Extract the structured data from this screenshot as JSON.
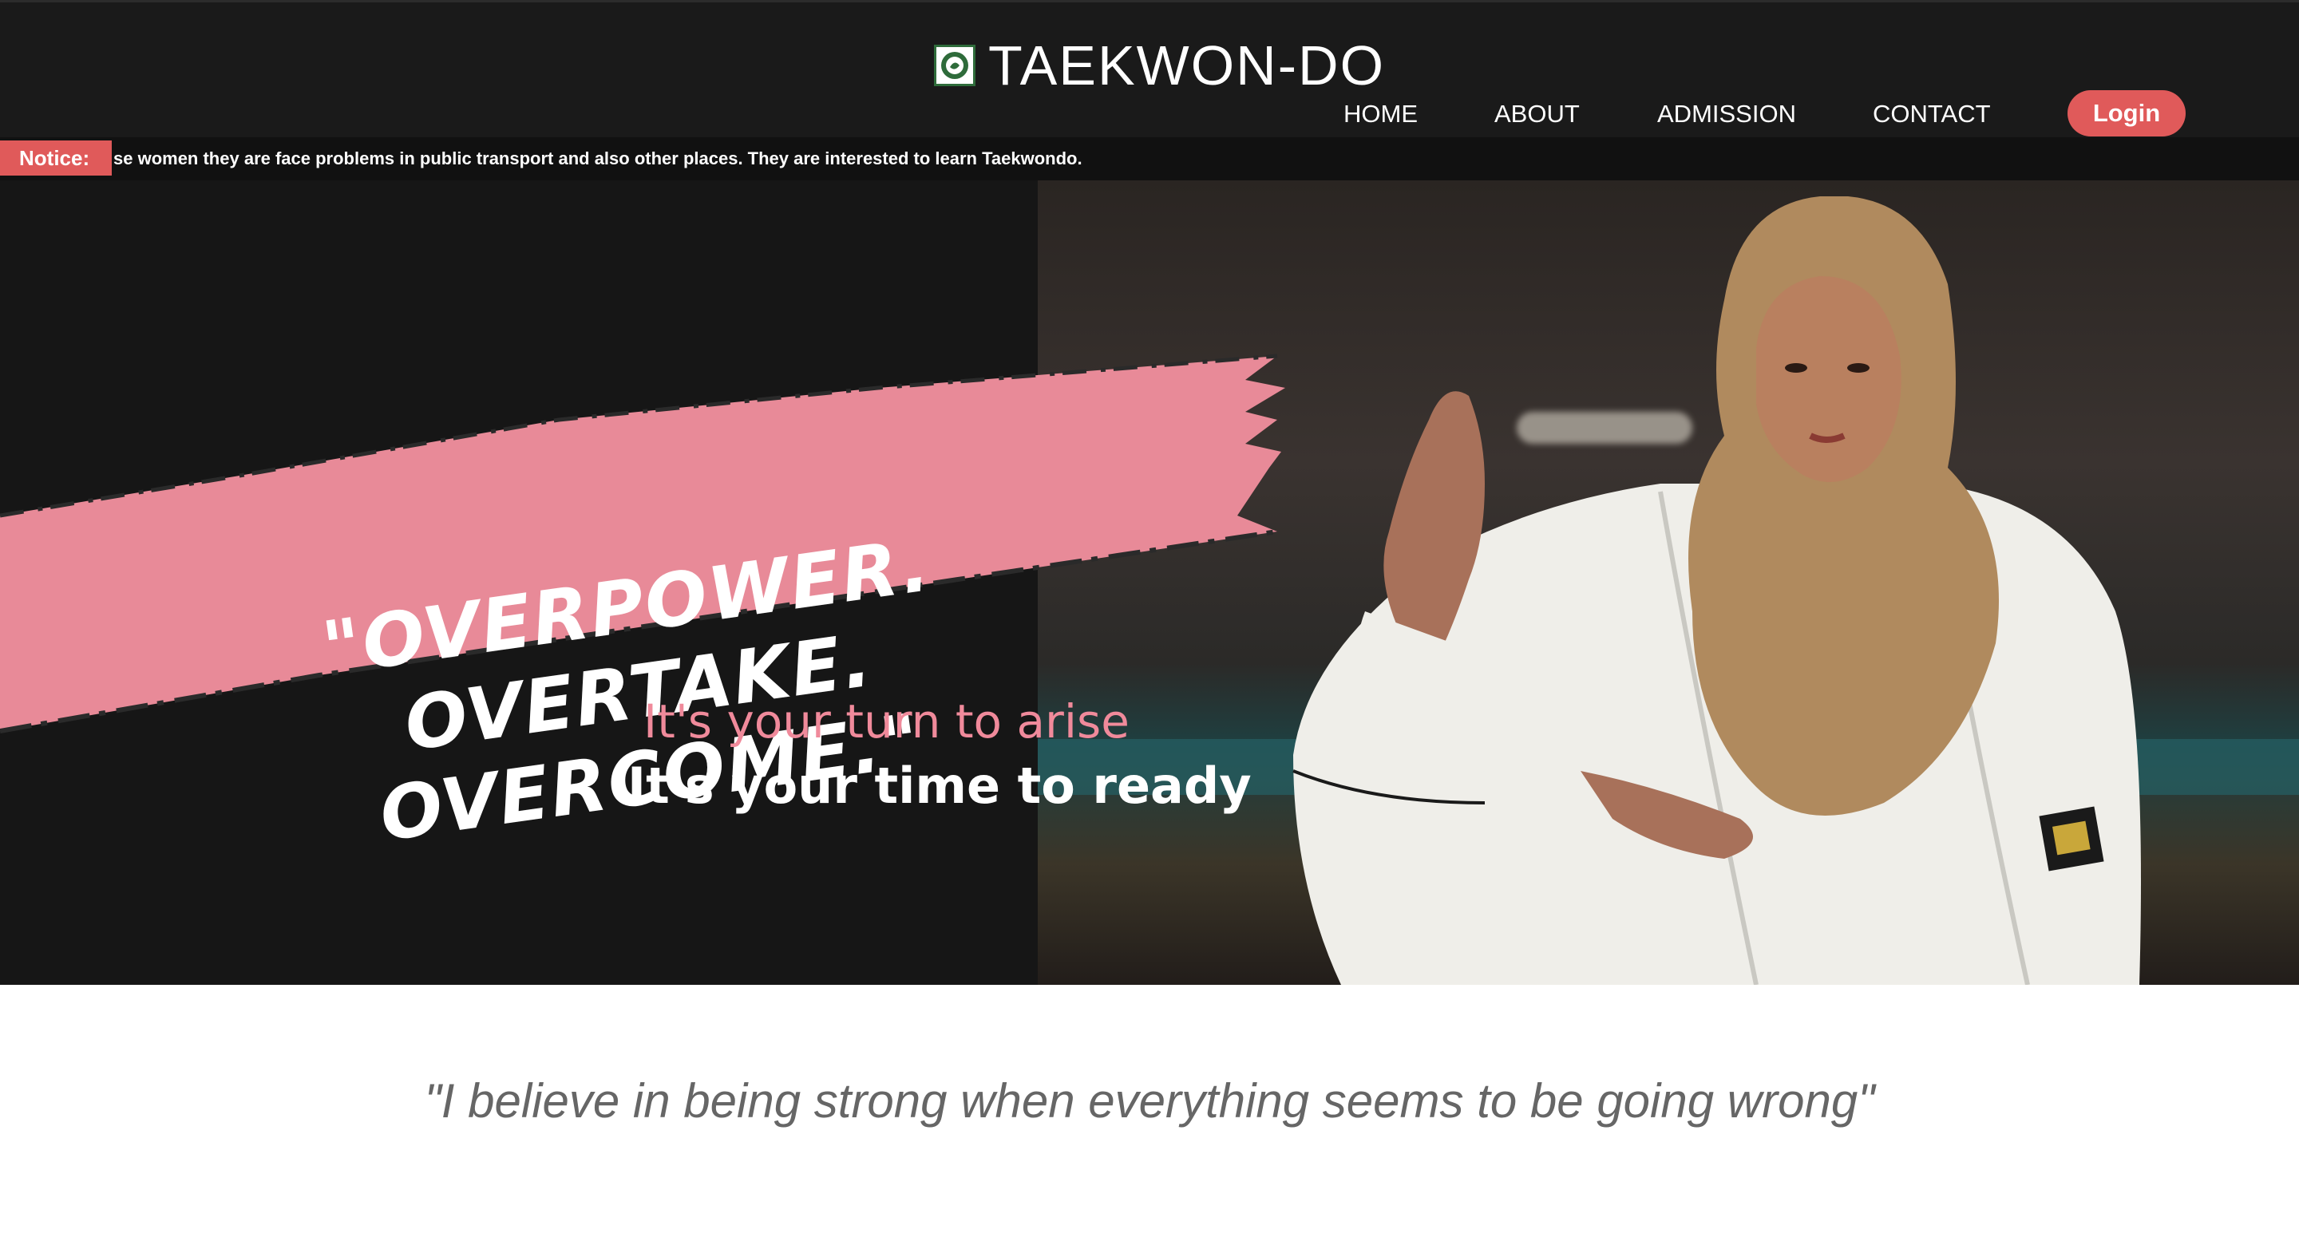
{
  "header": {
    "brand_title": "TAEKWON-DO",
    "logo_icon": "taekwondo-emblem",
    "nav": [
      {
        "label": "HOME",
        "active": true
      },
      {
        "label": "ABOUT",
        "active": false
      },
      {
        "label": "ADMISSION",
        "active": false
      },
      {
        "label": "CONTACT",
        "active": false
      }
    ],
    "login_label": "Login"
  },
  "notice": {
    "label": "Notice:",
    "text": "se women they are face problems in public transport and also other places. They are interested to learn Taekwondo."
  },
  "hero": {
    "slogan_line1": "\"OVERPOWER. OVERTAKE.",
    "slogan_line2": "OVERCOME.\"",
    "tagline1": "It's your turn to arise",
    "tagline2": "It's your time to ready"
  },
  "quote": {
    "text": "\"I believe in being strong when everything seems to be going wrong\""
  },
  "colors": {
    "accent": "#e05a5a",
    "brush_pink": "#e88a98",
    "header_bg": "#1a1a1a",
    "hero_bg": "#161616"
  }
}
